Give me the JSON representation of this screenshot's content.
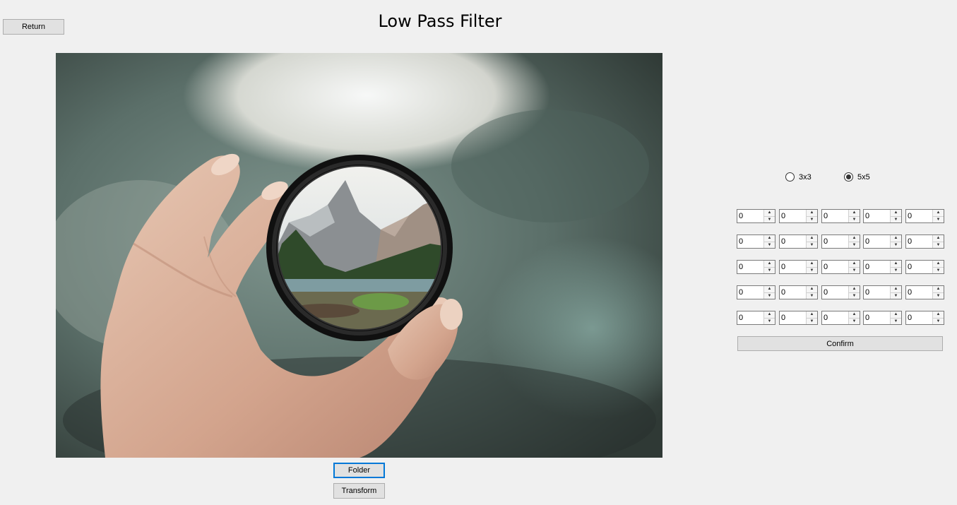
{
  "window": {
    "title": "Low Pass Filter"
  },
  "buttons": {
    "return_label": "Return",
    "folder_label": "Folder",
    "transform_label": "Transform",
    "confirm_label": "Confirm"
  },
  "kernel_size": {
    "options": [
      {
        "label": "3x3",
        "selected": false
      },
      {
        "label": "5x5",
        "selected": true
      }
    ]
  },
  "kernel_grid": {
    "rows": [
      [
        "0",
        "0",
        "0",
        "0",
        "0"
      ],
      [
        "0",
        "0",
        "0",
        "0",
        "0"
      ],
      [
        "0",
        "0",
        "0",
        "0",
        "0"
      ],
      [
        "0",
        "0",
        "0",
        "0",
        "0"
      ],
      [
        "0",
        "0",
        "0",
        "0",
        "0"
      ]
    ]
  },
  "colors": {
    "window_bg": "#f0f0f0",
    "button_bg": "#e1e1e1",
    "focus_accent": "#0078d7"
  },
  "icons": {
    "spin_up": "▲",
    "spin_down": "▼"
  }
}
